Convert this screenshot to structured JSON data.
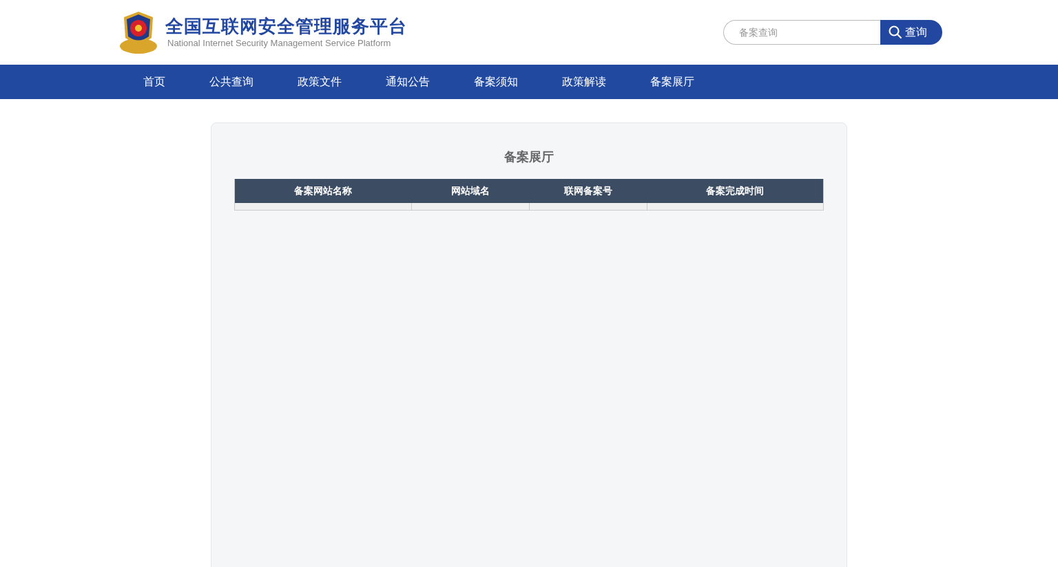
{
  "header": {
    "title": "全国互联网安全管理服务平台",
    "subtitle": "National Internet Security Management Service Platform"
  },
  "search": {
    "placeholder": "备案查询",
    "button": "查询"
  },
  "nav": {
    "items": [
      {
        "label": "首页"
      },
      {
        "label": "公共查询"
      },
      {
        "label": "政策文件"
      },
      {
        "label": "通知公告"
      },
      {
        "label": "备案须知"
      },
      {
        "label": "政策解读"
      },
      {
        "label": "备案展厅"
      }
    ]
  },
  "panel": {
    "title": "备案展厅",
    "table": {
      "columns": [
        "备案网站名称",
        "网站域名",
        "联网备案号",
        "备案完成时间"
      ]
    }
  }
}
